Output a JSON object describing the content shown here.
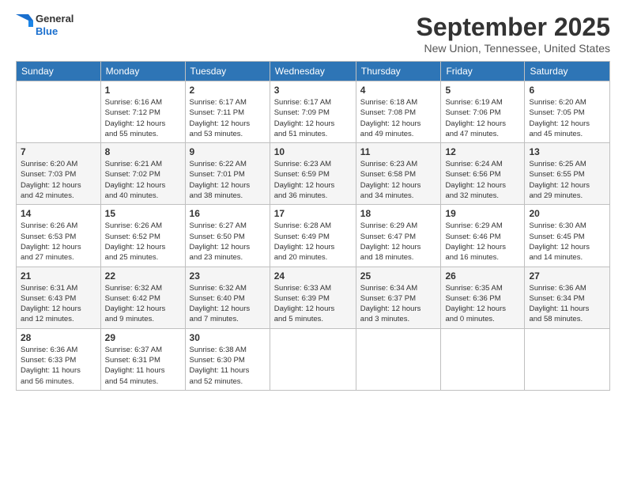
{
  "logo": {
    "line1": "General",
    "line2": "Blue"
  },
  "title": "September 2025",
  "location": "New Union, Tennessee, United States",
  "headers": [
    "Sunday",
    "Monday",
    "Tuesday",
    "Wednesday",
    "Thursday",
    "Friday",
    "Saturday"
  ],
  "weeks": [
    [
      {
        "day": "",
        "info": ""
      },
      {
        "day": "1",
        "info": "Sunrise: 6:16 AM\nSunset: 7:12 PM\nDaylight: 12 hours\nand 55 minutes."
      },
      {
        "day": "2",
        "info": "Sunrise: 6:17 AM\nSunset: 7:11 PM\nDaylight: 12 hours\nand 53 minutes."
      },
      {
        "day": "3",
        "info": "Sunrise: 6:17 AM\nSunset: 7:09 PM\nDaylight: 12 hours\nand 51 minutes."
      },
      {
        "day": "4",
        "info": "Sunrise: 6:18 AM\nSunset: 7:08 PM\nDaylight: 12 hours\nand 49 minutes."
      },
      {
        "day": "5",
        "info": "Sunrise: 6:19 AM\nSunset: 7:06 PM\nDaylight: 12 hours\nand 47 minutes."
      },
      {
        "day": "6",
        "info": "Sunrise: 6:20 AM\nSunset: 7:05 PM\nDaylight: 12 hours\nand 45 minutes."
      }
    ],
    [
      {
        "day": "7",
        "info": "Sunrise: 6:20 AM\nSunset: 7:03 PM\nDaylight: 12 hours\nand 42 minutes."
      },
      {
        "day": "8",
        "info": "Sunrise: 6:21 AM\nSunset: 7:02 PM\nDaylight: 12 hours\nand 40 minutes."
      },
      {
        "day": "9",
        "info": "Sunrise: 6:22 AM\nSunset: 7:01 PM\nDaylight: 12 hours\nand 38 minutes."
      },
      {
        "day": "10",
        "info": "Sunrise: 6:23 AM\nSunset: 6:59 PM\nDaylight: 12 hours\nand 36 minutes."
      },
      {
        "day": "11",
        "info": "Sunrise: 6:23 AM\nSunset: 6:58 PM\nDaylight: 12 hours\nand 34 minutes."
      },
      {
        "day": "12",
        "info": "Sunrise: 6:24 AM\nSunset: 6:56 PM\nDaylight: 12 hours\nand 32 minutes."
      },
      {
        "day": "13",
        "info": "Sunrise: 6:25 AM\nSunset: 6:55 PM\nDaylight: 12 hours\nand 29 minutes."
      }
    ],
    [
      {
        "day": "14",
        "info": "Sunrise: 6:26 AM\nSunset: 6:53 PM\nDaylight: 12 hours\nand 27 minutes."
      },
      {
        "day": "15",
        "info": "Sunrise: 6:26 AM\nSunset: 6:52 PM\nDaylight: 12 hours\nand 25 minutes."
      },
      {
        "day": "16",
        "info": "Sunrise: 6:27 AM\nSunset: 6:50 PM\nDaylight: 12 hours\nand 23 minutes."
      },
      {
        "day": "17",
        "info": "Sunrise: 6:28 AM\nSunset: 6:49 PM\nDaylight: 12 hours\nand 20 minutes."
      },
      {
        "day": "18",
        "info": "Sunrise: 6:29 AM\nSunset: 6:47 PM\nDaylight: 12 hours\nand 18 minutes."
      },
      {
        "day": "19",
        "info": "Sunrise: 6:29 AM\nSunset: 6:46 PM\nDaylight: 12 hours\nand 16 minutes."
      },
      {
        "day": "20",
        "info": "Sunrise: 6:30 AM\nSunset: 6:45 PM\nDaylight: 12 hours\nand 14 minutes."
      }
    ],
    [
      {
        "day": "21",
        "info": "Sunrise: 6:31 AM\nSunset: 6:43 PM\nDaylight: 12 hours\nand 12 minutes."
      },
      {
        "day": "22",
        "info": "Sunrise: 6:32 AM\nSunset: 6:42 PM\nDaylight: 12 hours\nand 9 minutes."
      },
      {
        "day": "23",
        "info": "Sunrise: 6:32 AM\nSunset: 6:40 PM\nDaylight: 12 hours\nand 7 minutes."
      },
      {
        "day": "24",
        "info": "Sunrise: 6:33 AM\nSunset: 6:39 PM\nDaylight: 12 hours\nand 5 minutes."
      },
      {
        "day": "25",
        "info": "Sunrise: 6:34 AM\nSunset: 6:37 PM\nDaylight: 12 hours\nand 3 minutes."
      },
      {
        "day": "26",
        "info": "Sunrise: 6:35 AM\nSunset: 6:36 PM\nDaylight: 12 hours\nand 0 minutes."
      },
      {
        "day": "27",
        "info": "Sunrise: 6:36 AM\nSunset: 6:34 PM\nDaylight: 11 hours\nand 58 minutes."
      }
    ],
    [
      {
        "day": "28",
        "info": "Sunrise: 6:36 AM\nSunset: 6:33 PM\nDaylight: 11 hours\nand 56 minutes."
      },
      {
        "day": "29",
        "info": "Sunrise: 6:37 AM\nSunset: 6:31 PM\nDaylight: 11 hours\nand 54 minutes."
      },
      {
        "day": "30",
        "info": "Sunrise: 6:38 AM\nSunset: 6:30 PM\nDaylight: 11 hours\nand 52 minutes."
      },
      {
        "day": "",
        "info": ""
      },
      {
        "day": "",
        "info": ""
      },
      {
        "day": "",
        "info": ""
      },
      {
        "day": "",
        "info": ""
      }
    ]
  ]
}
